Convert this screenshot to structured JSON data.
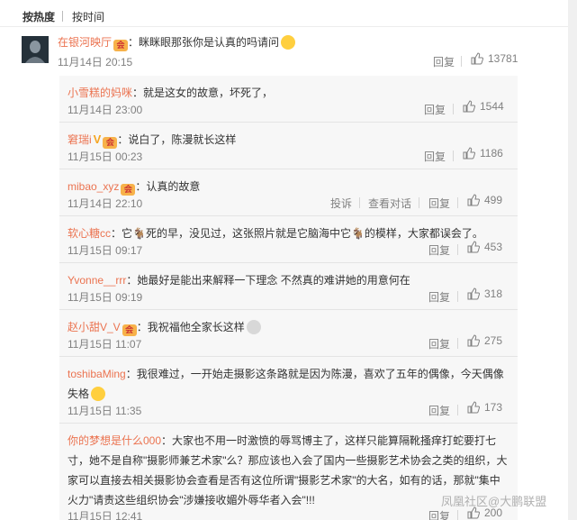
{
  "sort_tabs": {
    "hot": "按热度",
    "time": "按时间"
  },
  "main_comment": {
    "username": "在银河映厅",
    "badge": "会员",
    "text": "：眯眯眼那张你是认真的吗请问",
    "time": "11月14日 20:15",
    "reply_label": "回复",
    "likes": "13781"
  },
  "replies": [
    {
      "username": "小雪糕的妈咪",
      "text": "：就是这女的故意，坏死了，",
      "time": "11月14日 23:00",
      "reply_label": "回复",
      "likes": "1544"
    },
    {
      "username": "窘瑞i",
      "vmark": "V",
      "badge": "会员",
      "text": "：说白了，陈漫就长这样",
      "time": "11月15日 00:23",
      "reply_label": "回复",
      "likes": "1186"
    },
    {
      "username": "mibao_xyz",
      "badge": "会员",
      "text": "：认真的故意",
      "time": "11月14日 22:10",
      "report_label": "投诉",
      "view_label": "查看对话",
      "reply_label": "回复",
      "likes": "499"
    },
    {
      "username": "软心糖cc",
      "text": "：它🐐死的早，没见过，这张照片就是它脑海中它🐐的模样，大家都误会了。",
      "time": "11月15日 09:17",
      "reply_label": "回复",
      "likes": "453"
    },
    {
      "username": "Yvonne__rrr",
      "text": "：她最好是能出来解释一下理念 不然真的难讲她的用意何在",
      "time": "11月15日 09:19",
      "reply_label": "回复",
      "likes": "318"
    },
    {
      "username": "赵小甜V_V",
      "badge": "会员",
      "text": "：我祝福他全家长这样",
      "time": "11月15日 11:07",
      "reply_label": "回复",
      "likes": "275"
    },
    {
      "username": "toshibaMing",
      "text": "：我很难过，一开始走摄影这条路就是因为陈漫，喜欢了五年的偶像，今天偶像失格",
      "time": "11月15日 11:35",
      "reply_label": "回复",
      "likes": "173"
    },
    {
      "username": "你的梦想是什么000",
      "text": "：大家也不用一时激愤的辱骂博主了，这样只能算隔靴搔痒打蛇要打七寸，她不是自称\"摄影师兼艺术家\"么？那应该也入会了国内一些摄影艺术协会之类的组织，大家可以直接去相关摄影协会查看是否有这位所谓\"摄影艺术家\"的大名，如有的话，那就\"集中火力\"请责这些组织协会\"涉嫌接收媚外辱华者入会\"!!!",
      "time": "11月15日 12:41",
      "reply_label": "回复",
      "likes": "200"
    }
  ],
  "watermark": "凤凰社区@大鹏联盟"
}
